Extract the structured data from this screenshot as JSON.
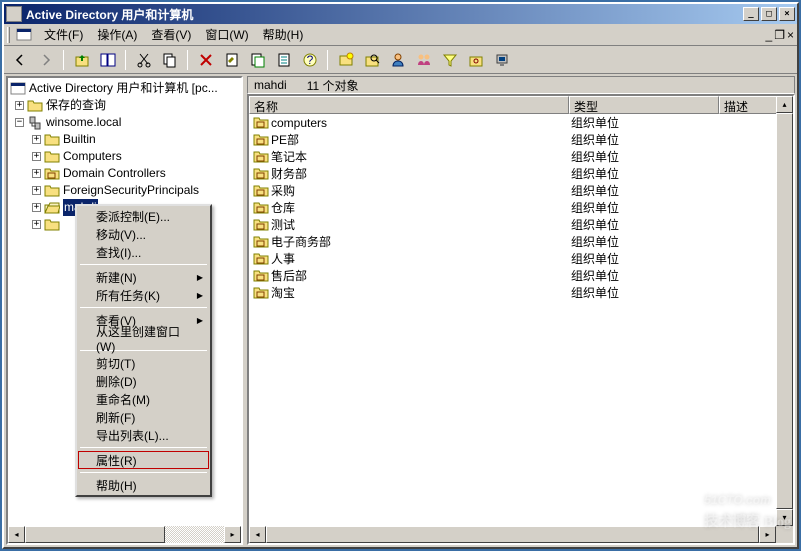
{
  "window": {
    "title": "Active Directory 用户和计算机"
  },
  "menubar": {
    "file": "文件(F)",
    "action": "操作(A)",
    "view": "查看(V)",
    "window": "窗口(W)",
    "help": "帮助(H)"
  },
  "tree": {
    "root": "Active Directory 用户和计算机 [pc...",
    "saved_queries": "保存的查询",
    "domain": "winsome.local",
    "nodes": {
      "builtin": "Builtin",
      "computers": "Computers",
      "dc": "Domain Controllers",
      "fsp": "ForeignSecurityPrincipals",
      "mahdi": "mahdi",
      "last": ""
    }
  },
  "pathbar": {
    "name": "mahdi",
    "count": "11 个对象"
  },
  "columns": {
    "name": "名称",
    "type": "类型",
    "desc": "描述"
  },
  "rows": [
    {
      "name": "computers",
      "type": "组织单位"
    },
    {
      "name": "PE部",
      "type": "组织单位"
    },
    {
      "name": "笔记本",
      "type": "组织单位"
    },
    {
      "name": "财务部",
      "type": "组织单位"
    },
    {
      "name": "采购",
      "type": "组织单位"
    },
    {
      "name": "仓库",
      "type": "组织单位"
    },
    {
      "name": "测试",
      "type": "组织单位"
    },
    {
      "name": "电子商务部",
      "type": "组织单位"
    },
    {
      "name": "人事",
      "type": "组织单位"
    },
    {
      "name": "售后部",
      "type": "组织单位"
    },
    {
      "name": "淘宝",
      "type": "组织单位"
    }
  ],
  "context_menu": {
    "delegate": "委派控制(E)...",
    "move": "移动(V)...",
    "find": "查找(I)...",
    "new": "新建(N)",
    "all_tasks": "所有任务(K)",
    "view": "查看(V)",
    "new_window": "从这里创建窗口(W)",
    "cut": "剪切(T)",
    "delete": "删除(D)",
    "rename": "重命名(M)",
    "refresh": "刷新(F)",
    "export_list": "导出列表(L)...",
    "properties": "属性(R)",
    "help": "帮助(H)"
  },
  "watermark": {
    "main": "51CTO.com",
    "sub": "技术博客  Blog"
  }
}
